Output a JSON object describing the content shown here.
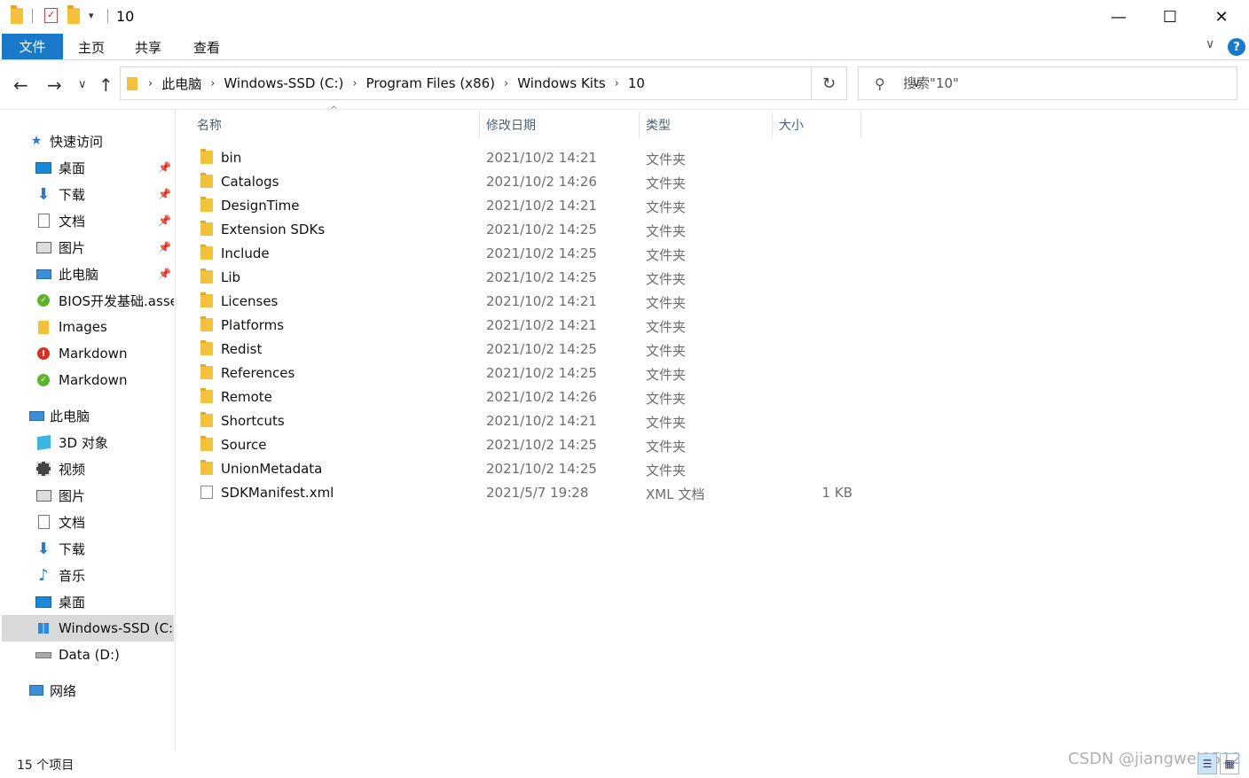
{
  "window": {
    "title": "10",
    "minimize_glyph": "—",
    "maximize_glyph": "☐",
    "close_glyph": "✕",
    "qa_dropdown_glyph": "▾"
  },
  "ribbon": {
    "file_tab": "文件",
    "tabs": [
      "主页",
      "共享",
      "查看"
    ],
    "expand_glyph": "∨",
    "help_glyph": "?"
  },
  "nav": {
    "back_glyph": "←",
    "forward_glyph": "→",
    "recent_glyph": "∨",
    "up_glyph": "↑",
    "refresh_glyph": "↻"
  },
  "address": {
    "breadcrumbs": [
      "此电脑",
      "Windows-SSD (C:)",
      "Program Files (x86)",
      "Windows Kits",
      "10"
    ],
    "separator": "›",
    "dropdown_glyph": "∨"
  },
  "search": {
    "placeholder": "搜索\"10\"",
    "icon": "search-icon"
  },
  "sidebar": {
    "quick_access": {
      "label": "快速访问",
      "items": [
        {
          "label": "桌面",
          "icon": "desktop-icon",
          "pinned": true
        },
        {
          "label": "下载",
          "icon": "download-icon",
          "pinned": true
        },
        {
          "label": "文档",
          "icon": "document-icon",
          "pinned": true
        },
        {
          "label": "图片",
          "icon": "pictures-icon",
          "pinned": true
        },
        {
          "label": "此电脑",
          "icon": "computer-icon",
          "pinned": true
        },
        {
          "label": "BIOS开发基础.asse",
          "icon": "synced-folder-icon",
          "pinned": false
        },
        {
          "label": "Images",
          "icon": "folder-icon",
          "pinned": false
        },
        {
          "label": "Markdown",
          "icon": "error-folder-icon",
          "pinned": false
        },
        {
          "label": "Markdown",
          "icon": "synced-folder-icon",
          "pinned": false
        }
      ]
    },
    "this_pc": {
      "label": "此电脑",
      "items": [
        {
          "label": "3D 对象",
          "icon": "3d-objects-icon"
        },
        {
          "label": "视频",
          "icon": "video-icon"
        },
        {
          "label": "图片",
          "icon": "pictures-icon"
        },
        {
          "label": "文档",
          "icon": "document-icon"
        },
        {
          "label": "下载",
          "icon": "download-icon"
        },
        {
          "label": "音乐",
          "icon": "music-icon"
        },
        {
          "label": "桌面",
          "icon": "desktop-icon"
        },
        {
          "label": "Windows-SSD (C:)",
          "icon": "windows-drive-icon",
          "selected": true
        },
        {
          "label": "Data (D:)",
          "icon": "drive-icon"
        }
      ]
    },
    "network": {
      "label": "网络",
      "icon": "network-icon"
    }
  },
  "columns": {
    "name": "名称",
    "date": "修改日期",
    "type": "类型",
    "size": "大小",
    "sort_glyph": "^"
  },
  "files": [
    {
      "name": "bin",
      "date": "2021/10/2 14:21",
      "type": "文件夹",
      "size": "",
      "kind": "folder"
    },
    {
      "name": "Catalogs",
      "date": "2021/10/2 14:26",
      "type": "文件夹",
      "size": "",
      "kind": "folder"
    },
    {
      "name": "DesignTime",
      "date": "2021/10/2 14:21",
      "type": "文件夹",
      "size": "",
      "kind": "folder"
    },
    {
      "name": "Extension SDKs",
      "date": "2021/10/2 14:25",
      "type": "文件夹",
      "size": "",
      "kind": "folder"
    },
    {
      "name": "Include",
      "date": "2021/10/2 14:25",
      "type": "文件夹",
      "size": "",
      "kind": "folder"
    },
    {
      "name": "Lib",
      "date": "2021/10/2 14:25",
      "type": "文件夹",
      "size": "",
      "kind": "folder"
    },
    {
      "name": "Licenses",
      "date": "2021/10/2 14:21",
      "type": "文件夹",
      "size": "",
      "kind": "folder"
    },
    {
      "name": "Platforms",
      "date": "2021/10/2 14:21",
      "type": "文件夹",
      "size": "",
      "kind": "folder"
    },
    {
      "name": "Redist",
      "date": "2021/10/2 14:25",
      "type": "文件夹",
      "size": "",
      "kind": "folder"
    },
    {
      "name": "References",
      "date": "2021/10/2 14:25",
      "type": "文件夹",
      "size": "",
      "kind": "folder"
    },
    {
      "name": "Remote",
      "date": "2021/10/2 14:26",
      "type": "文件夹",
      "size": "",
      "kind": "folder"
    },
    {
      "name": "Shortcuts",
      "date": "2021/10/2 14:21",
      "type": "文件夹",
      "size": "",
      "kind": "folder"
    },
    {
      "name": "Source",
      "date": "2021/10/2 14:25",
      "type": "文件夹",
      "size": "",
      "kind": "folder"
    },
    {
      "name": "UnionMetadata",
      "date": "2021/10/2 14:25",
      "type": "文件夹",
      "size": "",
      "kind": "folder"
    },
    {
      "name": "SDKManifest.xml",
      "date": "2021/5/7 19:28",
      "type": "XML 文档",
      "size": "1 KB",
      "kind": "file"
    }
  ],
  "status": {
    "item_count": "15 个项目",
    "watermark": "CSDN @jiangwei0512",
    "details_view_glyph": "☰",
    "large_icons_glyph": "▦"
  },
  "colors": {
    "accent": "#1979ca",
    "folder": "#f3c13a",
    "selected_bg": "#d9d9d9"
  }
}
